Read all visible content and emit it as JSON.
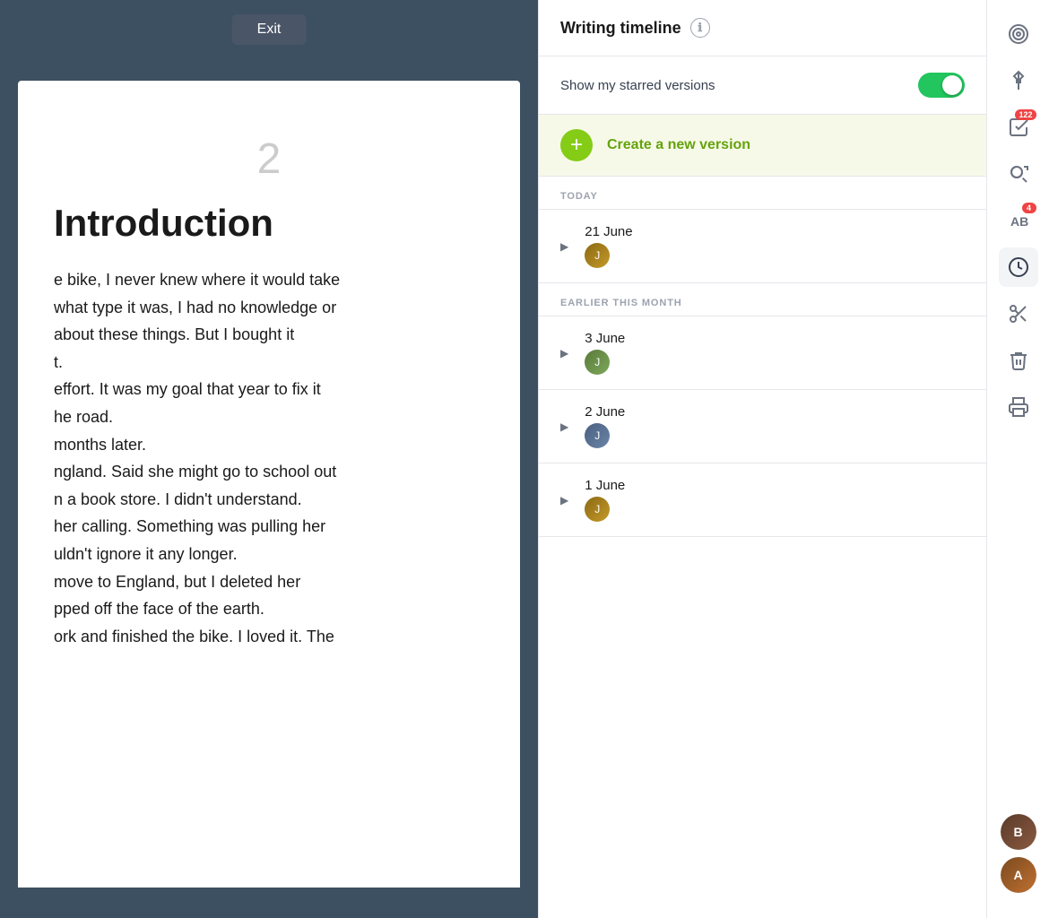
{
  "document": {
    "exit_button": "Exit",
    "page_number": "2",
    "heading": "Introduction",
    "body_text": "e bike, I never knew where it would take\nwhat type it was, I had no knowledge or\nabout these things. But I bought it\nt.\neffort. It was my goal that year to fix it\nhe road.\nmonths later.\nngland. Said she might go to school out\nn a book store. I didn't understand.\nher calling. Something was pulling her\nuldn't ignore it any longer.\nmove to England, but I deleted her\npped off the face of the earth.\nork and finished the bike. I loved it. The"
  },
  "timeline": {
    "title": "Writing timeline",
    "info_icon": "ℹ",
    "starred_label": "Show my starred versions",
    "toggle_state": "on",
    "create_label": "Create a new version",
    "sections": [
      {
        "header": "TODAY",
        "entries": [
          {
            "date": "21 June",
            "avatar_initial": "J",
            "avatar_class": "avatar-1"
          }
        ]
      },
      {
        "header": "EARLIER THIS MONTH",
        "entries": [
          {
            "date": "3 June",
            "avatar_initial": "J",
            "avatar_class": "avatar-2"
          },
          {
            "date": "2 June",
            "avatar_initial": "J",
            "avatar_class": "avatar-3"
          },
          {
            "date": "1 June",
            "avatar_initial": "J",
            "avatar_class": "avatar-1"
          }
        ]
      }
    ]
  },
  "sidebar": {
    "icons": [
      {
        "name": "target-icon",
        "symbol": "🎯",
        "badge": null
      },
      {
        "name": "pin-icon",
        "symbol": "📌",
        "badge": null
      },
      {
        "name": "checklist-icon",
        "symbol": "✓",
        "badge": "122"
      },
      {
        "name": "search-refresh-icon",
        "symbol": "🔍",
        "badge": null
      },
      {
        "name": "text-icon",
        "symbol": "AB",
        "badge": "4"
      },
      {
        "name": "clock-icon",
        "symbol": "🕐",
        "badge": null,
        "active": true
      },
      {
        "name": "scissors-icon",
        "symbol": "✂",
        "badge": null
      },
      {
        "name": "trash-icon",
        "symbol": "🗑",
        "badge": null
      },
      {
        "name": "print-icon",
        "symbol": "🖨",
        "badge": null
      }
    ],
    "bottom_avatars": [
      {
        "name": "user-avatar-1",
        "initial": "B",
        "class": "avatar-b1"
      },
      {
        "name": "user-avatar-2",
        "initial": "A",
        "class": "avatar-b2"
      }
    ]
  }
}
